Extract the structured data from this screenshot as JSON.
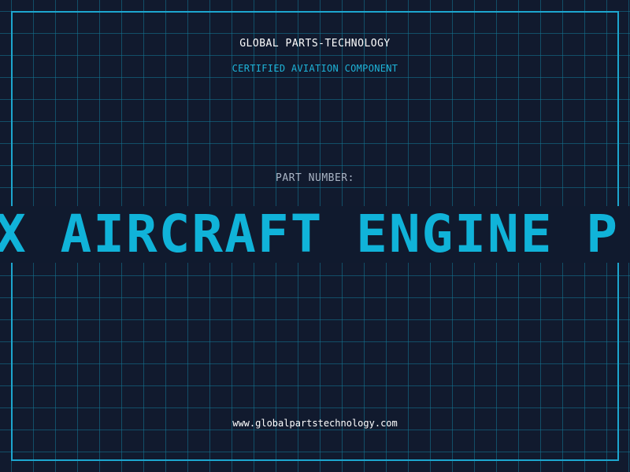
{
  "header": {
    "brand": "GLOBAL PARTS-TECHNOLOGY",
    "subtitle": "CERTIFIED AVIATION COMPONENT"
  },
  "part": {
    "label": "PART NUMBER:",
    "marquee_text": "X AIRCRAFT ENGINE P"
  },
  "footer": {
    "website": "www.globalpartstechnology.com"
  },
  "colors": {
    "background": "#111a2e",
    "grid": "#127896",
    "accent": "#1da6cf",
    "text_primary": "#ffffff",
    "text_muted": "#a9b4c4"
  }
}
